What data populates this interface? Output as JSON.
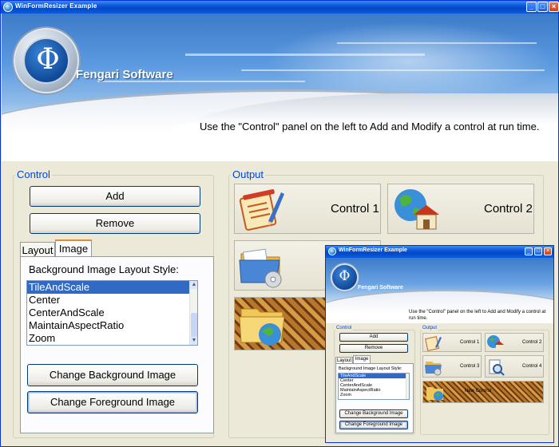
{
  "window": {
    "title": "WinFormResizer Example",
    "buttons": {
      "minimize": "_",
      "maximize": "□",
      "close": "×"
    }
  },
  "header": {
    "logo_glyph": "Φ",
    "brand": "Fengari Software",
    "instruction": "Use the \"Control\" panel on the left to Add and Modify a control at run time."
  },
  "control_panel": {
    "label": "Control",
    "add_label": "Add",
    "remove_label": "Remove",
    "tabs": [
      {
        "label": "Layout"
      },
      {
        "label": "Image"
      }
    ],
    "active_tab": "Image",
    "layout_style_label": "Background Image Layout Style:",
    "layout_options": [
      "TileAndScale",
      "Center",
      "CenterAndScale",
      "MaintainAspectRatio",
      "Zoom"
    ],
    "selected_option": "TileAndScale",
    "change_background_label": "Change Background Image",
    "change_foreground_label": "Change Foreground Image"
  },
  "output_panel": {
    "label": "Output",
    "tiles": [
      {
        "label": "Control 1",
        "icon": "notepad-pencil-icon"
      },
      {
        "label": "Control 2",
        "icon": "globe-house-icon"
      }
    ]
  },
  "nested_window": {
    "title": "WinFormResizer Example",
    "brand": "Fengari Software",
    "instruction": "Use the \"Control\" panel on the left to Add and Modify a control at run time.",
    "control_label": "Control",
    "add_label": "Add",
    "remove_label": "Remove",
    "tabs": [
      {
        "label": "Layout"
      },
      {
        "label": "Image"
      }
    ],
    "layout_style_label": "Background Image Layout Style:",
    "layout_options": [
      "TileAndScale",
      "Center",
      "CenterAndScale",
      "MaintainAspectRatio",
      "Zoom"
    ],
    "change_background_label": "Change Background Image",
    "change_foreground_label": "Change Foreground Image",
    "output_label": "Output",
    "tiles": [
      {
        "label": "Control 1"
      },
      {
        "label": "Control 2"
      },
      {
        "label": "Control 3"
      },
      {
        "label": "Control 4"
      },
      {
        "label": "New Control"
      }
    ]
  },
  "colors": {
    "titlebar": "#0a56d9",
    "group_label": "#0046d5",
    "selection": "#316ac5",
    "tab_highlight": "#e68b2c",
    "window_face": "#ece9d8"
  }
}
